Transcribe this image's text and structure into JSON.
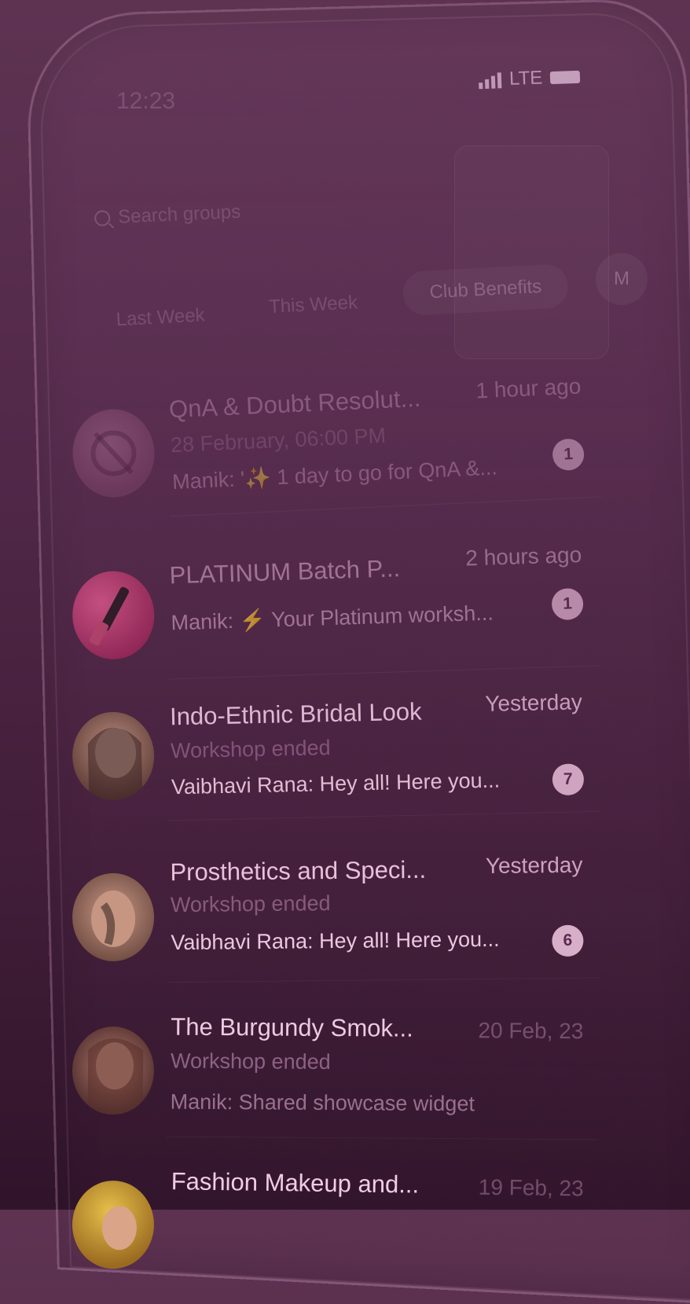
{
  "status": {
    "time": "12:23",
    "network": "LTE"
  },
  "search": {
    "placeholder": "Search groups"
  },
  "tabs": [
    {
      "label": "Last Week"
    },
    {
      "label": "This Week"
    },
    {
      "label": "Club Benefits"
    }
  ],
  "profile": {
    "initial": "M"
  },
  "chats": [
    {
      "title": "QnA & Doubt Resolut...",
      "time": "1 hour ago",
      "subtitle": "28 February, 06:00 PM",
      "message": "Manik: '✨ 1 day to go for QnA &...",
      "unread": "1"
    },
    {
      "title": "PLATINUM Batch P...",
      "time": "2 hours ago",
      "subtitle": "",
      "message": "Manik: ⚡ Your Platinum worksh...",
      "unread": "1"
    },
    {
      "title": "Indo-Ethnic Bridal Look",
      "time": "Yesterday",
      "subtitle": "Workshop ended",
      "message": "Vaibhavi Rana: Hey all! Here you...",
      "unread": "7"
    },
    {
      "title": "Prosthetics and Speci...",
      "time": "Yesterday",
      "subtitle": "Workshop ended",
      "message": "Vaibhavi Rana: Hey all! Here you...",
      "unread": "6"
    },
    {
      "title": "The Burgundy Smok...",
      "time": "20 Feb, 23",
      "subtitle": "Workshop ended",
      "message": "Manik: Shared showcase widget",
      "unread": ""
    },
    {
      "title": "Fashion Makeup and...",
      "time": "19 Feb, 23",
      "subtitle": "",
      "message": "",
      "unread": ""
    }
  ],
  "colors": {
    "background": "#4f2646",
    "text_bright": "#e9c7de",
    "text_dim": "#a7759a"
  }
}
